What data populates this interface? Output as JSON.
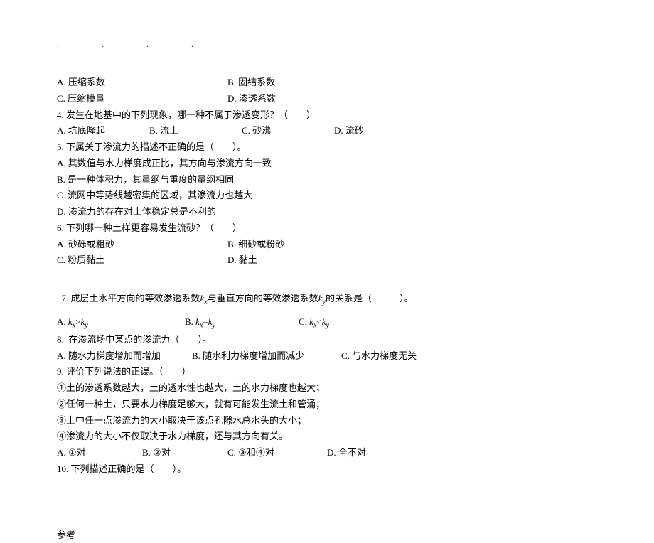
{
  "header_dots": [
    ".",
    ".",
    ".",
    "."
  ],
  "q_options_ab_cd_1": {
    "a": "A. 压缩系数",
    "b": "B. 固结系数",
    "c": "C. 压缩模量",
    "d": "D. 渗透系数"
  },
  "q4": {
    "stem": "4. 发生在地基中的下列现象，哪一种不属于渗透变形？（        ）",
    "a": "A. 坑底隆起",
    "b": "B. 流土",
    "c": "C. 砂沸",
    "d": "D. 流砂"
  },
  "q5": {
    "stem": "5. 下属关于渗流力的描述不正确的是（        ）。",
    "a": "A. 其数值与水力梯度成正比，其方向与渗流方向一致",
    "b": "B. 是一种体积力，其量纲与重度的量纲相同",
    "c": "C. 流网中等势线越密集的区域，其渗流力也越大",
    "d": "D. 渗流力的存在对土体稳定总是不利的"
  },
  "q6": {
    "stem": "6. 下列哪一种土样更容易发生流砂？（        ）",
    "a": "A. 砂砾或粗砂",
    "b": "B. 细砂或粉砂",
    "c": "C. 粉质黏土",
    "d": "D. 黏土"
  },
  "q7": {
    "stem_pre": "7. 成层土水平方向的等效渗透系数",
    "kx_label": "k",
    "kx_sub": "x",
    "stem_mid": "与垂直方向的等效渗透系数",
    "ky_label": "k",
    "ky_sub": "y",
    "stem_post": "的关系是（            ）。",
    "a_pre": "A. ",
    "a_rel": ">",
    "b_pre": "B. ",
    "b_rel": "=",
    "c_pre": "C. ",
    "c_rel": "<"
  },
  "q8": {
    "stem": "8.  在渗流场中某点的渗流力（        ）。",
    "a": "A. 随水力梯度增加而增加",
    "b": "B. 随水利力梯度增加而减少",
    "c": "C. 与水力梯度无关"
  },
  "q9": {
    "stem": "9. 评价下列说法的正误。（        ）",
    "s1": "①土的渗透系数越大，土的透水性也越大，土的水力梯度也越大；",
    "s2": "②任何一种土，只要水力梯度足够大，就有可能发生流土和管涌；",
    "s3": "③土中任一点渗流力的大小取决于该点孔隙水总水头的大小；",
    "s4": "④渗流力的大小不仅取决于水力梯度，还与其方向有关。",
    "a": "A. ①对",
    "b": "B. ②对",
    "c": "C. ③和④对",
    "d": "D. 全不对"
  },
  "q10": {
    "stem": "10. 下列描述正确的是（        ）。"
  },
  "footer": "参考"
}
